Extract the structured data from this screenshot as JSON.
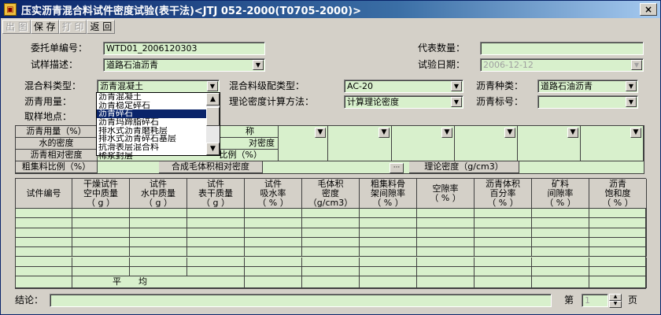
{
  "window": {
    "title": "压实沥青混合料试件密度试验(表干法)<JTJ 052-2000(T0705-2000)>",
    "icon": "app-icon",
    "close": "×"
  },
  "toolbar": {
    "new": "出 图",
    "save": "保 存",
    "print": "打 印",
    "back": "返 回"
  },
  "form": {
    "weituo_label": "委托单编号：",
    "weituo_value": "WTD01_2006120303",
    "daibiao_label": "代表数量：",
    "daibiao_value": "",
    "miaoshu_label": "试样描述：",
    "miaoshu_value": "道路石油沥青",
    "riqi_label": "试验日期：",
    "riqi_value": "2006-12-12",
    "hunheliao_label": "混合料类型：",
    "hunheliao_value": "沥青混凝土",
    "jipei_label": "混合料级配类型：",
    "jipei_value": "AC-20",
    "liqingzl_label": "沥青种类：",
    "liqingzl_value": "道路石油沥青",
    "liqingyl_label": "沥青用量：",
    "lilun_label": "理论密度计算方法：",
    "lilun_value": "计算理论密度",
    "biaohao_label": "沥青标号：",
    "biaohao_value": "",
    "didian_label": "取样地点："
  },
  "dropdown": {
    "items": [
      "沥青混凝土",
      "沥青稳定碎石",
      "沥青碎石",
      "沥青玛蹄脂碎石",
      "排水式沥青磨耗层",
      "排水式沥青碎石基层",
      "抗滑表层混合料",
      "稀浆封层"
    ],
    "selected_index": 2,
    "up": "▲",
    "down": "▼"
  },
  "mix": {
    "r1": "沥青用量（%）",
    "r1b": "称",
    "r2": "水的密度",
    "r2b": "对密度",
    "r3": "沥青相对密度",
    "r3b": "比例（%）",
    "r4": "粗集料比例（%）",
    "r4b": "合成毛体积相对密度",
    "r4c": "理论密度（g/cm3）",
    "ellipsis": "···"
  },
  "table": {
    "headers": [
      "试件编号",
      "干燥试件\n空中质量\n（ g ）",
      "试件\n水中质量\n（ g ）",
      "试件\n表干质量\n（ g ）",
      "试件\n吸水率\n（ % ）",
      "毛体积\n密度\n（g/cm3）",
      "粗集料骨\n架间隙率\n（ % ）",
      "空隙率\n（ % ）",
      "沥青体积\n百分率\n（ % ）",
      "矿料\n间隙率\n（ % ）",
      "沥青\n饱和度\n（ % ）"
    ],
    "avg_label": "平　　均"
  },
  "footer": {
    "conclusion_label": "结论：",
    "conclusion_value": "",
    "page_label": "第",
    "page_value": "1",
    "page_unit": "页"
  }
}
